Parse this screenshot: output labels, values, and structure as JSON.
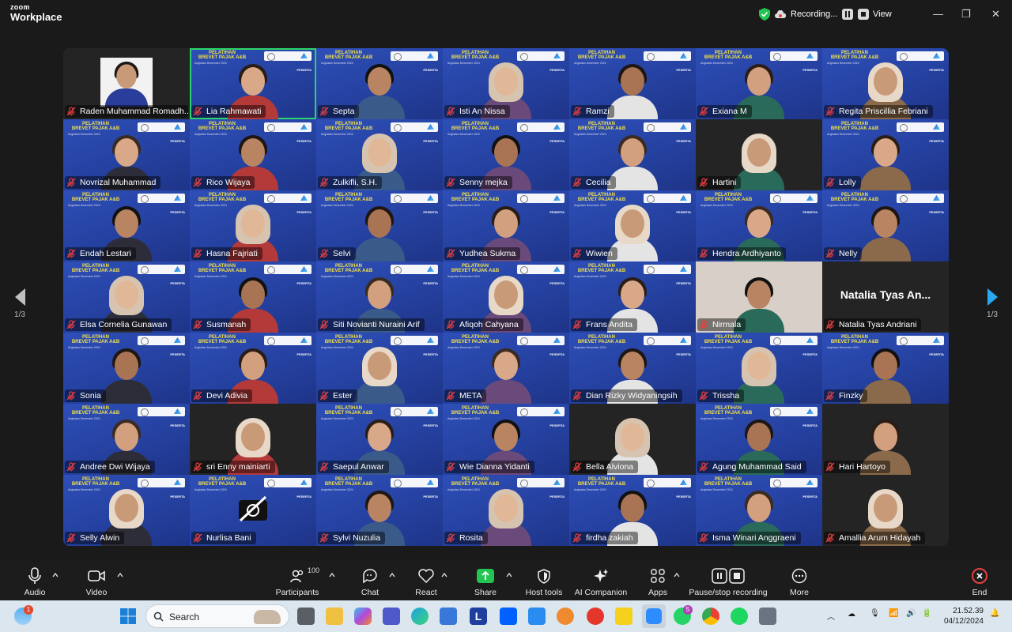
{
  "app": {
    "brand_top": "zoom",
    "brand_bottom": "Workplace",
    "recording_label": "Recording...",
    "view_label": "View"
  },
  "colors": {
    "active_speaker": "#2bd46b",
    "share_green": "#23c552",
    "end_red": "#e54040",
    "banner_blue": "#2541a0",
    "accent_blue": "#29a8f0"
  },
  "banner": {
    "title_line1": "PELATIHAN",
    "title_line2": "BREVET PAJAK A&B",
    "subtitle": "Angkatan Desember 2024",
    "peserta": "PESERTA"
  },
  "participants": [
    {
      "name": "Raden Muhammad Romadh...",
      "bg": "photo"
    },
    {
      "name": "Lia Rahmawati",
      "bg": "banner",
      "active": true
    },
    {
      "name": "Septa",
      "bg": "banner"
    },
    {
      "name": "Isti An Nissa",
      "bg": "banner"
    },
    {
      "name": "Ramzi",
      "bg": "banner"
    },
    {
      "name": "Exiana M",
      "bg": "banner"
    },
    {
      "name": "Regita Priscillia Febriani",
      "bg": "banner"
    },
    {
      "name": "Novrizal Muhammad",
      "bg": "banner"
    },
    {
      "name": "Rico Wijaya",
      "bg": "banner"
    },
    {
      "name": "Zulkifli, S.H.",
      "bg": "banner"
    },
    {
      "name": "Senny mejka",
      "bg": "banner"
    },
    {
      "name": "Cecilia",
      "bg": "banner"
    },
    {
      "name": "Hartini",
      "bg": "dark"
    },
    {
      "name": "Lolly",
      "bg": "banner"
    },
    {
      "name": "Endah Lestari",
      "bg": "banner"
    },
    {
      "name": "Hasna Fajriati",
      "bg": "banner"
    },
    {
      "name": "Selvi",
      "bg": "banner"
    },
    {
      "name": "Yudhea Sukma",
      "bg": "banner"
    },
    {
      "name": "Wiwien",
      "bg": "banner"
    },
    {
      "name": "Hendra Ardhiyanto",
      "bg": "banner"
    },
    {
      "name": "Nelly",
      "bg": "banner"
    },
    {
      "name": "Elsa Cornelia Gunawan",
      "bg": "banner"
    },
    {
      "name": "Susmanah",
      "bg": "banner"
    },
    {
      "name": "Siti Novianti Nuraini Arif",
      "bg": "banner"
    },
    {
      "name": "Afiqoh Cahyana",
      "bg": "banner"
    },
    {
      "name": "Frans Andita",
      "bg": "banner"
    },
    {
      "name": "Nirmala",
      "bg": "light"
    },
    {
      "name": "Natalia Tyas Andriani",
      "bg": "dark",
      "large": "Natalia Tyas An..."
    },
    {
      "name": "Sonia",
      "bg": "banner"
    },
    {
      "name": "Devi Adivia",
      "bg": "banner"
    },
    {
      "name": "Ester",
      "bg": "banner"
    },
    {
      "name": "META",
      "bg": "banner"
    },
    {
      "name": "Dian Rizky Widyaningsih",
      "bg": "banner"
    },
    {
      "name": "Trissha",
      "bg": "banner"
    },
    {
      "name": "Finzky",
      "bg": "banner"
    },
    {
      "name": "Andree Dwi Wijaya",
      "bg": "banner"
    },
    {
      "name": "sri Enny mainiarti",
      "bg": "dark"
    },
    {
      "name": "Saepul Anwar",
      "bg": "banner"
    },
    {
      "name": "Wie Dianna Yidanti",
      "bg": "banner"
    },
    {
      "name": "Bella Alviona",
      "bg": "dark"
    },
    {
      "name": "Agung Muhammad Said",
      "bg": "banner"
    },
    {
      "name": "Hari Hartoyo",
      "bg": "dark"
    },
    {
      "name": "Selly Alwin",
      "bg": "banner"
    },
    {
      "name": "Nurlisa Bani",
      "bg": "banner",
      "camoff": true
    },
    {
      "name": "Sylvi Nuzulia",
      "bg": "banner"
    },
    {
      "name": "Rosita",
      "bg": "banner"
    },
    {
      "name": "firdha zakiah",
      "bg": "banner"
    },
    {
      "name": "Isma Winari Anggraeni",
      "bg": "banner"
    },
    {
      "name": "Amallia Arum Hidayah",
      "bg": "dark"
    }
  ],
  "pager": {
    "left": "1/3",
    "right": "1/3"
  },
  "toolbar": {
    "audio": "Audio",
    "video": "Video",
    "participants": "Participants",
    "participants_count": "100",
    "chat": "Chat",
    "react": "React",
    "share": "Share",
    "host_tools": "Host tools",
    "ai_companion": "AI Companion",
    "apps": "Apps",
    "pause_stop": "Pause/stop recording",
    "more": "More",
    "end": "End"
  },
  "taskbar": {
    "search_placeholder": "Search",
    "weather_badge": "1",
    "whatsapp_badge": "5",
    "time": "21.52.39",
    "date": "04/12/2024"
  }
}
